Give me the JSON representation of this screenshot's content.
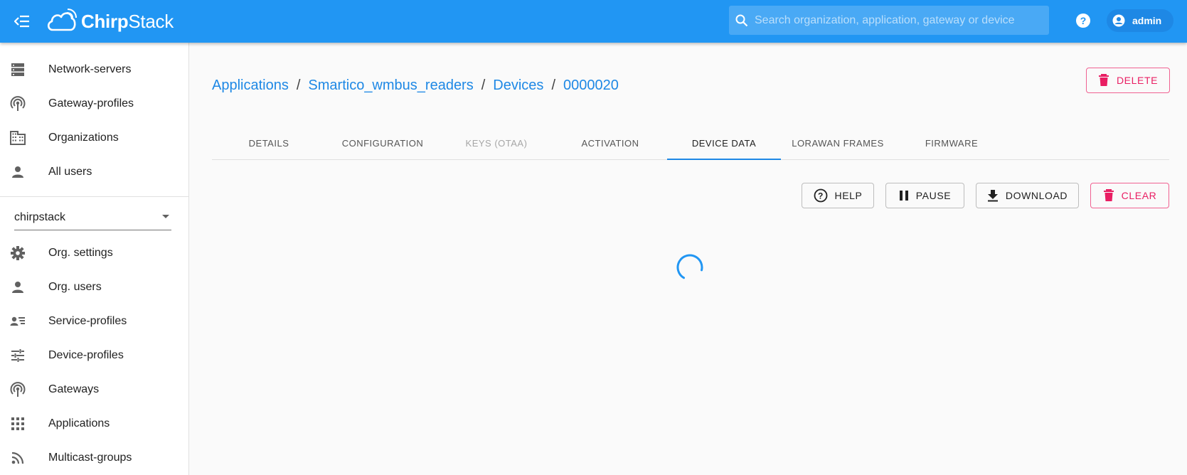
{
  "appbar": {
    "logo": {
      "prefix": "Chirp",
      "suffix": "Stack"
    },
    "search_placeholder": "Search organization, application, gateway or device",
    "user": "admin"
  },
  "sidebar": {
    "admin_items": [
      {
        "label": "Network-servers",
        "icon": "server-icon"
      },
      {
        "label": "Gateway-profiles",
        "icon": "antenna-icon"
      },
      {
        "label": "Organizations",
        "icon": "building-icon"
      },
      {
        "label": "All users",
        "icon": "person-icon"
      }
    ],
    "organization": "chirpstack",
    "org_items": [
      {
        "label": "Org. settings",
        "icon": "gear-icon"
      },
      {
        "label": "Org. users",
        "icon": "person-icon"
      },
      {
        "label": "Service-profiles",
        "icon": "account-details-icon"
      },
      {
        "label": "Device-profiles",
        "icon": "tune-icon"
      },
      {
        "label": "Gateways",
        "icon": "antenna-icon"
      },
      {
        "label": "Applications",
        "icon": "apps-grid-icon"
      },
      {
        "label": "Multicast-groups",
        "icon": "rss-icon"
      }
    ]
  },
  "breadcrumb": {
    "items": [
      "Applications",
      "Smartico_wmbus_readers",
      "Devices",
      "0000020"
    ],
    "separator": "/"
  },
  "actions": {
    "delete": "DELETE"
  },
  "tabs": [
    {
      "label": "DETAILS",
      "state": "normal"
    },
    {
      "label": "CONFIGURATION",
      "state": "normal"
    },
    {
      "label": "KEYS (OTAA)",
      "state": "disabled"
    },
    {
      "label": "ACTIVATION",
      "state": "normal"
    },
    {
      "label": "DEVICE DATA",
      "state": "active"
    },
    {
      "label": "LORAWAN FRAMES",
      "state": "normal"
    },
    {
      "label": "FIRMWARE",
      "state": "normal"
    }
  ],
  "toolbar": {
    "help": "HELP",
    "pause": "PAUSE",
    "download": "DOWNLOAD",
    "clear": "CLEAR"
  },
  "colors": {
    "primary": "#2196f3",
    "link": "#1e88e5",
    "danger": "#e91e63"
  }
}
